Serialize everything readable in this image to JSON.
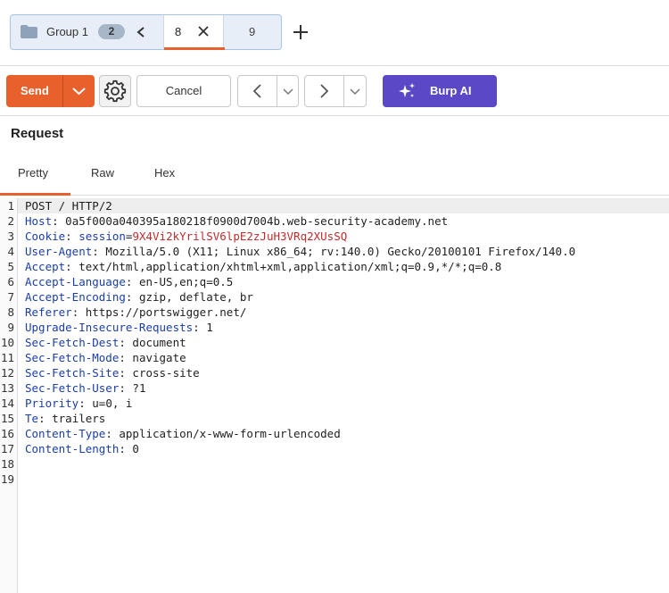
{
  "tabs": {
    "group_label": "Group 1",
    "group_count": "2",
    "active_tab": "8",
    "other_tab": "9"
  },
  "toolbar": {
    "send_label": "Send",
    "cancel_label": "Cancel",
    "burp_ai_label": "Burp AI"
  },
  "request": {
    "title": "Request",
    "view_tabs": [
      "Pretty",
      "Raw",
      "Hex"
    ],
    "line_numbers": [
      "1",
      "2",
      "3",
      "4",
      "5",
      "6",
      "7",
      "8",
      "9",
      "10",
      "11",
      "12",
      "13",
      "14",
      "15",
      "16",
      "17",
      "18",
      "19"
    ],
    "lines": [
      {
        "key": "",
        "sep": "",
        "value": "POST / HTTP/2"
      },
      {
        "key": "Host",
        "sep": ": ",
        "value": "0a5f000a040395a180218f0900d7004b.web-security-academy.net"
      },
      {
        "key": "Cookie",
        "sep": ": ",
        "cookie_name": "session",
        "cookie_value": "9X4Vi2kYrilSV6lpE2zJuH3VRq2XUsSQ"
      },
      {
        "key": "User-Agent",
        "sep": ": ",
        "value": "Mozilla/5.0 (X11; Linux x86_64; rv:140.0) Gecko/20100101 Firefox/140.0"
      },
      {
        "key": "Accept",
        "sep": ": ",
        "value": "text/html,application/xhtml+xml,application/xml;q=0.9,*/*;q=0.8"
      },
      {
        "key": "Accept-Language",
        "sep": ": ",
        "value": "en-US,en;q=0.5"
      },
      {
        "key": "Accept-Encoding",
        "sep": ": ",
        "value": "gzip, deflate, br"
      },
      {
        "key": "Referer",
        "sep": ": ",
        "value": "https://portswigger.net/"
      },
      {
        "key": "Upgrade-Insecure-Requests",
        "sep": ": ",
        "value": "1"
      },
      {
        "key": "Sec-Fetch-Dest",
        "sep": ": ",
        "value": "document"
      },
      {
        "key": "Sec-Fetch-Mode",
        "sep": ": ",
        "value": "navigate"
      },
      {
        "key": "Sec-Fetch-Site",
        "sep": ": ",
        "value": "cross-site"
      },
      {
        "key": "Sec-Fetch-User",
        "sep": ": ",
        "value": "?1"
      },
      {
        "key": "Priority",
        "sep": ": ",
        "value": "u=0, i"
      },
      {
        "key": "Te",
        "sep": ": ",
        "value": "trailers"
      },
      {
        "key": "Content-Type",
        "sep": ": ",
        "value": "application/x-www-form-urlencoded"
      },
      {
        "key": "Content-Length",
        "sep": ": ",
        "value": "0"
      },
      {
        "key": "",
        "sep": "",
        "value": ""
      },
      {
        "key": "",
        "sep": "",
        "value": ""
      }
    ]
  },
  "colors": {
    "accent": "#e8612c",
    "burp_ai": "#5a48c7",
    "header_key": "#1a3ea8",
    "cookie_value": "#c22c2c"
  },
  "icons": [
    "folder-icon",
    "chevron-left-icon",
    "close-icon",
    "plus-icon",
    "chevron-down-icon",
    "gear-icon",
    "arrow-left-icon",
    "arrow-right-icon",
    "sparkle-icon"
  ]
}
